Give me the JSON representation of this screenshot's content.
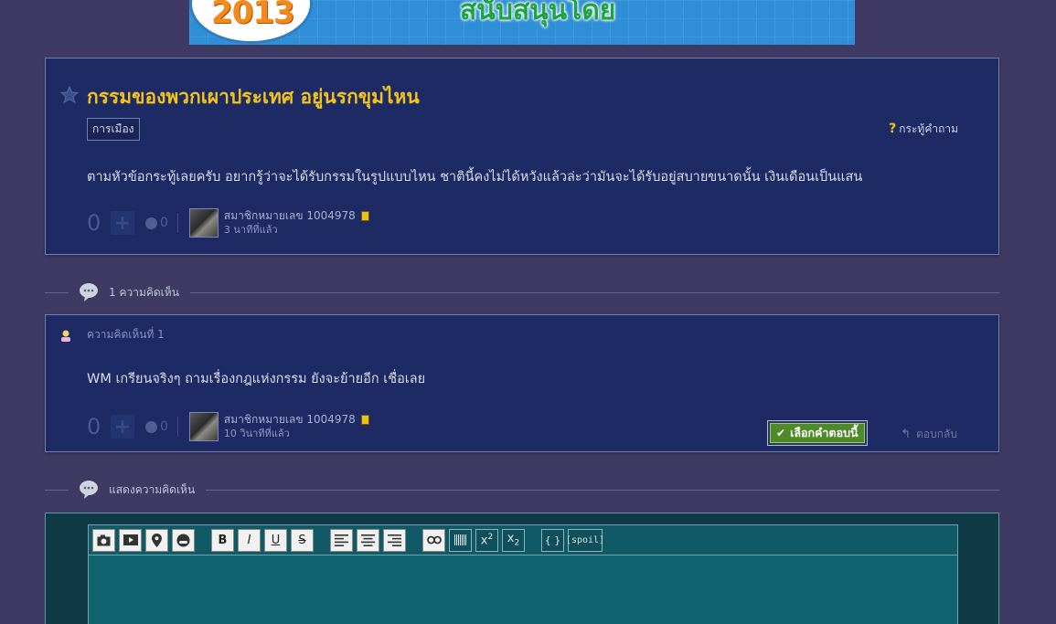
{
  "banner": {
    "year": "2013",
    "sponsor_text": "สนับสนุนโดย"
  },
  "topic": {
    "title": "กรรมของพวกเผาประเทศ อยู่นรกขุมไหน",
    "tag": "การเมือง",
    "type_label": "กระทู้คำถาม",
    "body": "ตามหัวข้อกระทู้เลยครับ อยากรู้ว่าจะได้รับกรรมในรูปแบบไหน ชาตินี้คงไม่ได้หวังแล้วล่ะว่ามันจะได้รับอยู่สบายขนาดนั้น เงินเดือนเป็นแสน",
    "votes": "0",
    "emotions": "0",
    "author": "สมาชิกหมายเลข 1004978",
    "time": "3 นาทีที่แล้ว"
  },
  "comments_header": {
    "label": "1 ความคิดเห็น"
  },
  "reply": {
    "heading": "ความคิดเห็นที่ 1",
    "body": "WM เกรียนจริงๆ ถามเรื่องกฎแห่งกรรม ยังจะย้ายอีก เชื่อเลย",
    "votes": "0",
    "emotions": "0",
    "author": "สมาชิกหมายเลข 1004978",
    "time": "10 วินาทีที่แล้ว",
    "choose_label": "เลือกคำตอบนี้",
    "reply_label": "ตอบกลับ"
  },
  "compose_header": {
    "label": "แสดงความคิดเห็น"
  },
  "toolbar": {
    "bold": "B",
    "italic": "I",
    "underline": "U",
    "strike": "S",
    "sup": "x",
    "sub": "x",
    "code": "{ }",
    "spoil": "[spoil]"
  },
  "colors": {
    "title": "#f2c31a",
    "card_bg": "#1d2a63",
    "page_bg": "#3f3a63",
    "choose_btn": "#4f8a2a"
  }
}
